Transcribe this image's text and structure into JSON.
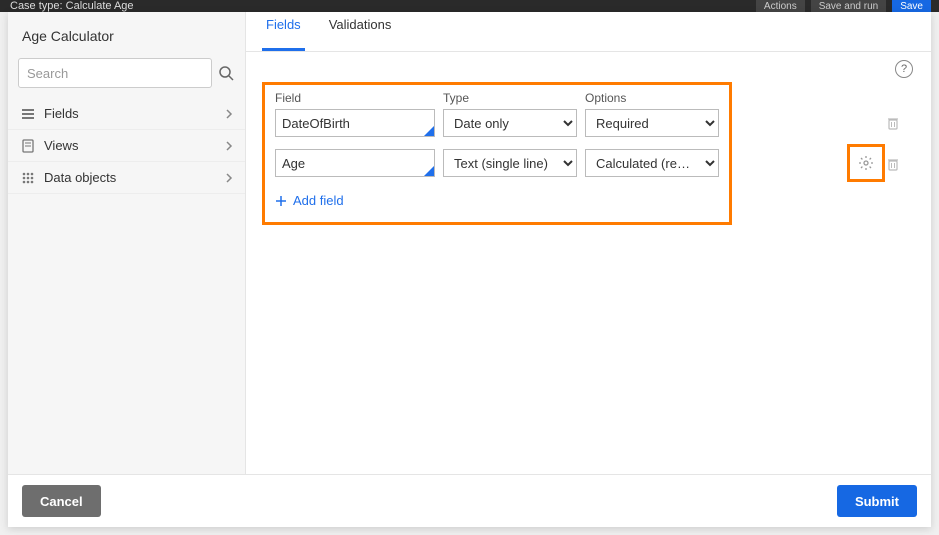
{
  "backdrop": {
    "context_label": "Case type: Calculate Age",
    "btn1": "Actions",
    "btn2": "Save and run",
    "btn3": "Save"
  },
  "title": "Age Calculator",
  "search": {
    "placeholder": "Search"
  },
  "nav": {
    "items": [
      {
        "label": "Fields"
      },
      {
        "label": "Views"
      },
      {
        "label": "Data objects"
      }
    ]
  },
  "tabs": [
    {
      "label": "Fields",
      "active": true
    },
    {
      "label": "Validations",
      "active": false
    }
  ],
  "columns": {
    "field": "Field",
    "type": "Type",
    "options": "Options"
  },
  "rows": [
    {
      "field": "DateOfBirth",
      "type": "Date only",
      "options": "Required"
    },
    {
      "field": "Age",
      "type": "Text (single line)",
      "options": "Calculated (read-only)"
    }
  ],
  "add_field_label": "Add field",
  "footer": {
    "cancel": "Cancel",
    "submit": "Submit"
  }
}
